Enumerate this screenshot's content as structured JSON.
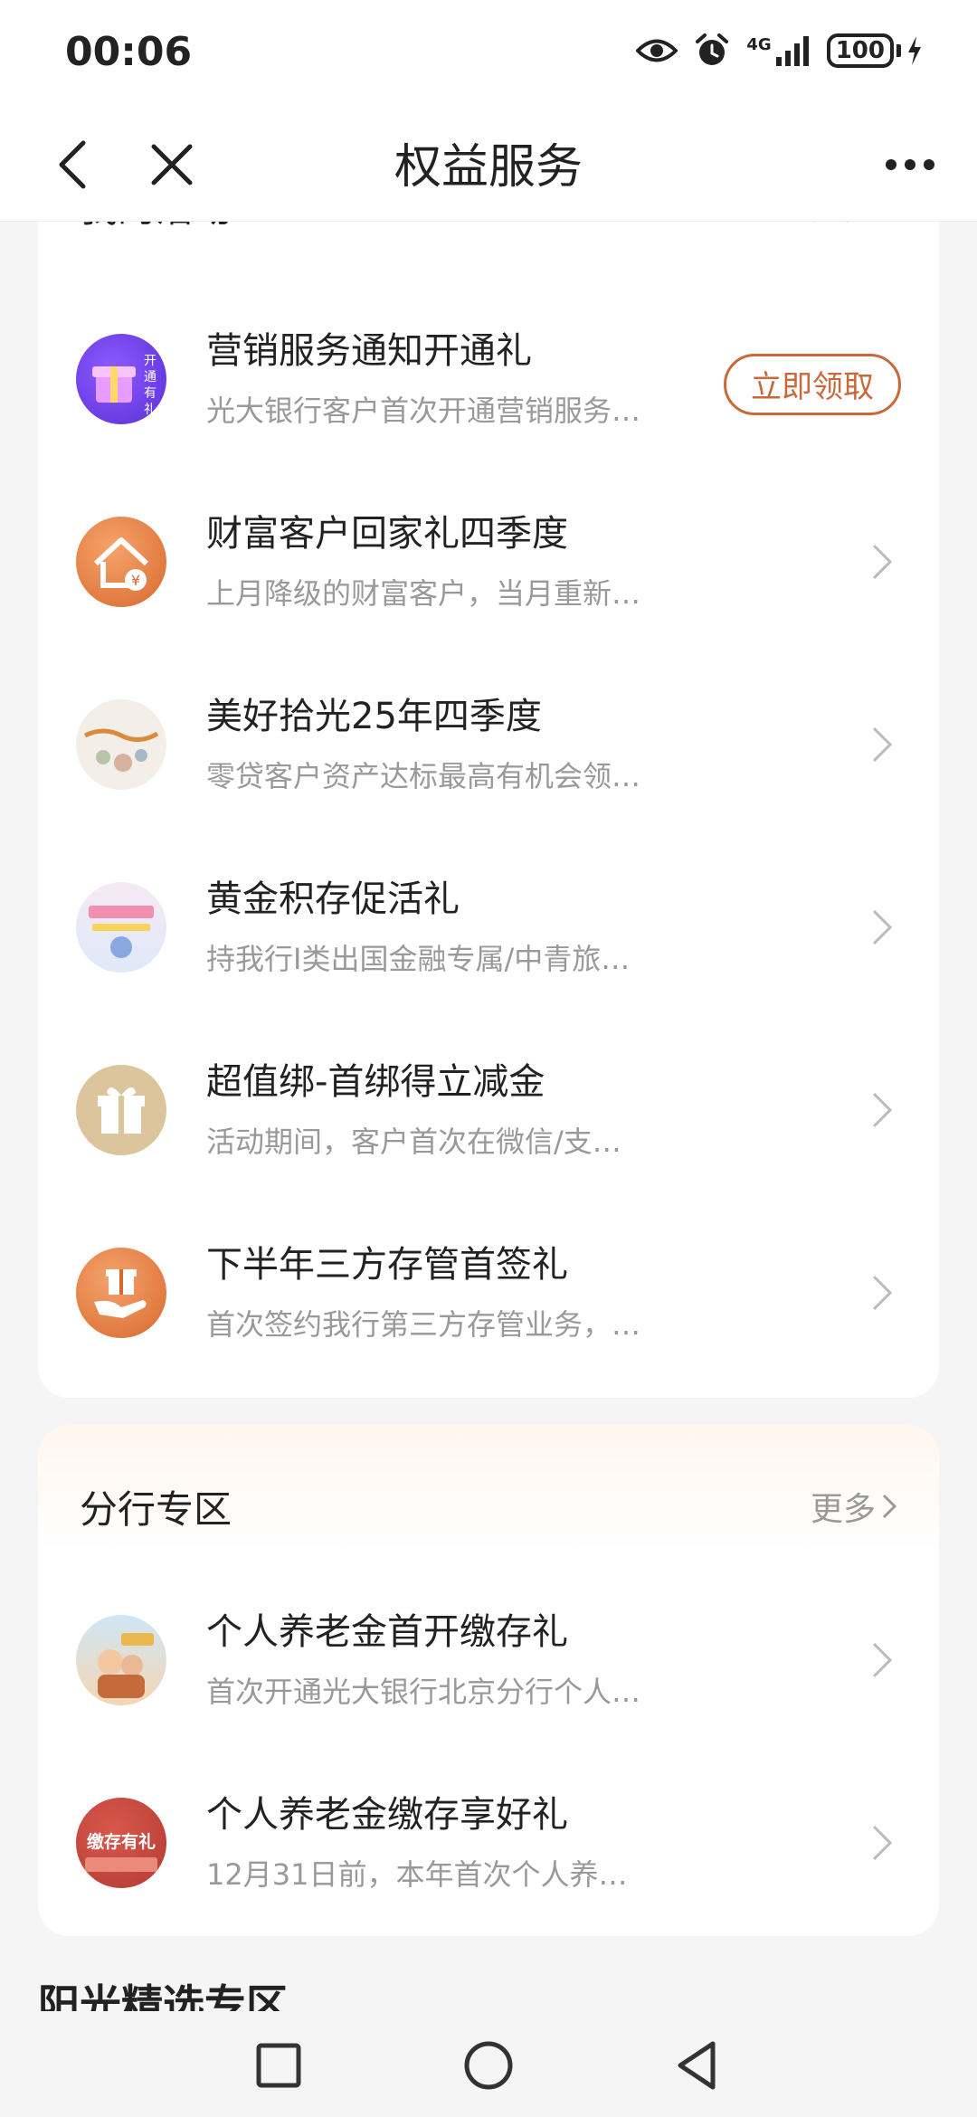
{
  "status": {
    "time": "00:06",
    "network": "4G",
    "battery": "100"
  },
  "nav": {
    "title": "权益服务"
  },
  "activities": {
    "title": "我的活动",
    "more": "更多",
    "items": [
      {
        "title": "营销服务通知开通礼",
        "desc": "光大银行客户首次开通营销服务…",
        "action": "立即领取",
        "icon": "gift-box-icon"
      },
      {
        "title": "财富客户回家礼四季度",
        "desc": "上月降级的财富客户，当月重新…",
        "icon": "house-yuan-icon"
      },
      {
        "title": "美好拾光25年四季度",
        "desc": "零贷客户资产达标最高有机会领…",
        "icon": "meihao-shiguang-icon"
      },
      {
        "title": "黄金积存促活礼",
        "desc": "持我行I类出国金融专属/中青旅…",
        "icon": "gold-promo-icon"
      },
      {
        "title": "超值绑-首绑得立减金",
        "desc": "活动期间，客户首次在微信/支…",
        "icon": "gift-icon"
      },
      {
        "title": "下半年三方存管首签礼",
        "desc": "首次签约我行第三方存管业务，…",
        "icon": "hand-gift-icon"
      }
    ]
  },
  "branch": {
    "title": "分行专区",
    "more": "更多",
    "items": [
      {
        "title": "个人养老金首开缴存礼",
        "desc": "首次开通光大银行北京分行个人…",
        "icon": "pension-icon"
      },
      {
        "title": "个人养老金缴存享好礼",
        "desc": "12月31日前，本年首次个人养…",
        "icon": "deposit-gift-icon",
        "badge": "缴存有礼"
      }
    ]
  },
  "next_section": {
    "title": "阳光精选专区"
  },
  "colors": {
    "accent": "#c8693a",
    "text": "#222222",
    "muted": "#999999"
  }
}
